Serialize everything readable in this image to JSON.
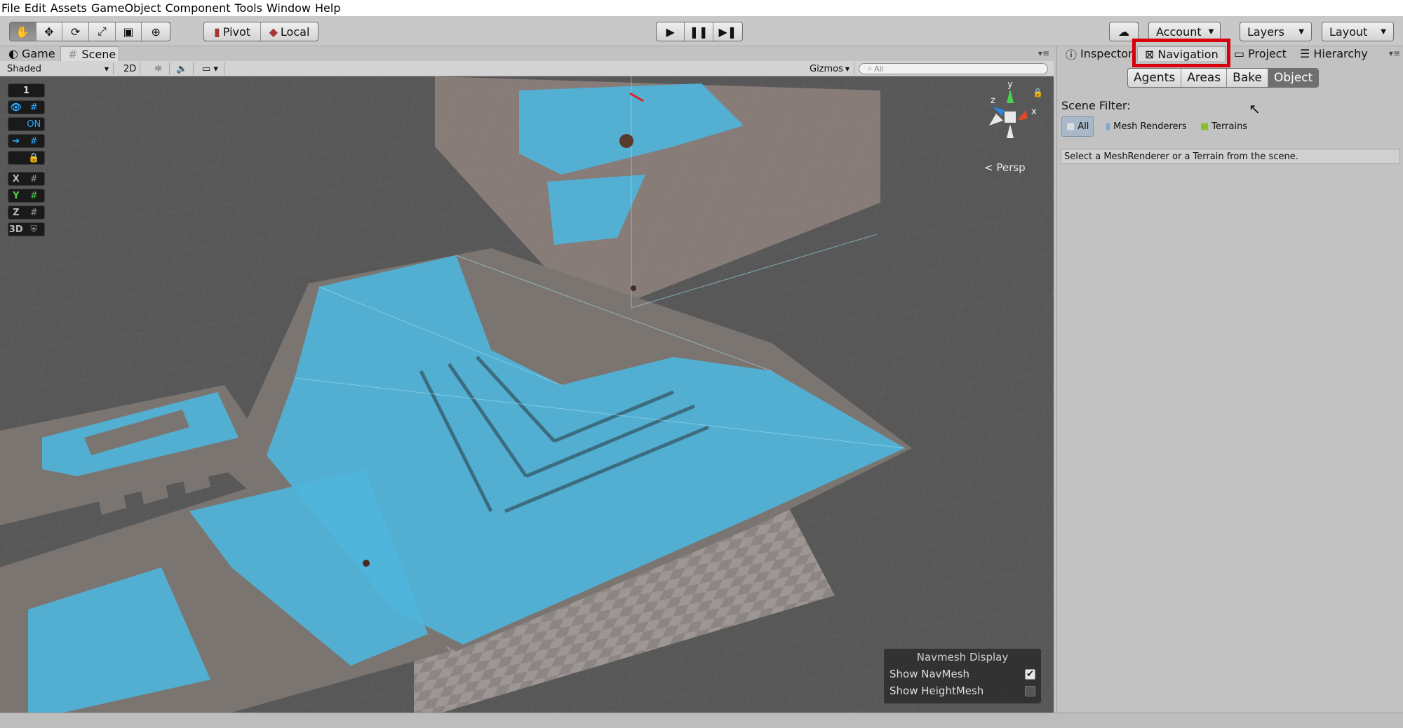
{
  "menu": [
    "File",
    "Edit",
    "Assets",
    "GameObject",
    "Component",
    "Tools",
    "Window",
    "Help"
  ],
  "toolbar": {
    "pivot_label": "Pivot",
    "local_label": "Local",
    "account_label": "Account",
    "layers_label": "Layers",
    "layout_label": "Layout"
  },
  "scene_tabs": {
    "game": "Game",
    "scene": "Scene"
  },
  "scene_bar": {
    "shading": "Shaded",
    "mode_2d": "2D",
    "gizmos": "Gizmos",
    "search_placeholder": "All"
  },
  "overlay_buttons": [
    {
      "left": "1",
      "right": ""
    },
    {
      "left": "",
      "right": ""
    },
    {
      "left": "",
      "right": "ON"
    },
    {
      "left": "",
      "right": ""
    },
    {
      "left": "",
      "right": ""
    },
    {
      "left": "X",
      "right": ""
    },
    {
      "left": "Y",
      "right": ""
    },
    {
      "left": "Z",
      "right": ""
    },
    {
      "left": "3D",
      "right": ""
    }
  ],
  "gizmo": {
    "x": "x",
    "y": "y",
    "z": "z",
    "persp": "Persp"
  },
  "navmesh_display": {
    "title": "Navmesh Display",
    "show_navmesh": "Show NavMesh",
    "show_navmesh_checked": true,
    "show_heightmesh": "Show HeightMesh",
    "show_heightmesh_checked": false
  },
  "right_tabs": [
    "Inspector",
    "Navigation",
    "Project",
    "Hierarchy"
  ],
  "nav_tabs": [
    "Agents",
    "Areas",
    "Bake",
    "Object"
  ],
  "nav_active": "Object",
  "scene_filter": {
    "label": "Scene Filter:",
    "options": [
      "All",
      "Mesh Renderers",
      "Terrains"
    ],
    "hint": "Select a MeshRenderer or a Terrain from the scene."
  },
  "colors": {
    "navmesh": "#4fb6dc",
    "highlight": "#d8000c",
    "ground": "#5a5a5a"
  }
}
